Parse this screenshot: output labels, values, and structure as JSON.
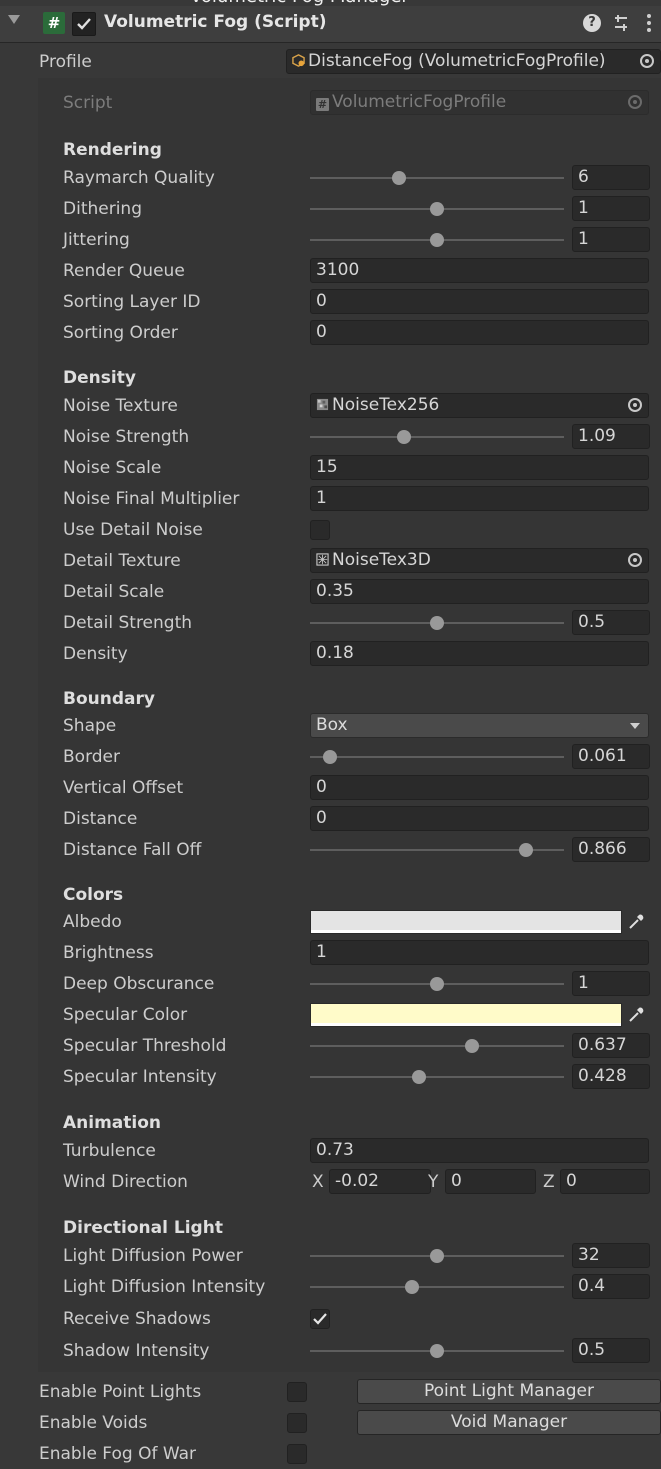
{
  "header": {
    "title": "Volumetric Fog (Script)",
    "help_icon_glyph": "?",
    "script_icon_glyph": "#"
  },
  "profile": {
    "label": "Profile",
    "value": "DistanceFog (VolumetricFogProfile)"
  },
  "script": {
    "label": "Script",
    "value": "VolumetricFogProfile"
  },
  "sections": {
    "rendering": "Rendering",
    "density": "Density",
    "boundary": "Boundary",
    "colors": "Colors",
    "animation": "Animation",
    "directional_light": "Directional Light"
  },
  "rendering": {
    "raymarch_quality": {
      "label": "Raymarch Quality",
      "value": "6",
      "level": 0.35
    },
    "dithering": {
      "label": "Dithering",
      "value": "1",
      "level": 0.5
    },
    "jittering": {
      "label": "Jittering",
      "value": "1",
      "level": 0.5
    },
    "render_queue": {
      "label": "Render Queue",
      "value": "3100"
    },
    "sorting_layer_id": {
      "label": "Sorting Layer ID",
      "value": "0"
    },
    "sorting_order": {
      "label": "Sorting Order",
      "value": "0"
    }
  },
  "density": {
    "noise_texture": {
      "label": "Noise Texture",
      "value": "NoiseTex256"
    },
    "noise_strength": {
      "label": "Noise Strength",
      "value": "1.09",
      "level": 0.37
    },
    "noise_scale": {
      "label": "Noise Scale",
      "value": "15"
    },
    "noise_final_multiplier": {
      "label": "Noise Final Multiplier",
      "value": "1"
    },
    "use_detail_noise": {
      "label": "Use Detail Noise",
      "checked": false
    },
    "detail_texture": {
      "label": "Detail Texture",
      "value": "NoiseTex3D"
    },
    "detail_scale": {
      "label": "Detail Scale",
      "value": "0.35"
    },
    "detail_strength": {
      "label": "Detail Strength",
      "value": "0.5",
      "level": 0.5
    },
    "density": {
      "label": "Density",
      "value": "0.18"
    }
  },
  "boundary": {
    "shape": {
      "label": "Shape",
      "value": "Box"
    },
    "border": {
      "label": "Border",
      "value": "0.061",
      "level": 0.08
    },
    "vertical_offset": {
      "label": "Vertical Offset",
      "value": "0"
    },
    "distance": {
      "label": "Distance",
      "value": "0"
    },
    "distance_fall_off": {
      "label": "Distance Fall Off",
      "value": "0.866",
      "level": 0.85
    }
  },
  "colors": {
    "albedo": {
      "label": "Albedo",
      "color": "#e4e4e4"
    },
    "brightness": {
      "label": "Brightness",
      "value": "1"
    },
    "deep_obscurance": {
      "label": "Deep Obscurance",
      "value": "1",
      "level": 0.5
    },
    "specular_color": {
      "label": "Specular Color",
      "color": "#fffbc9"
    },
    "specular_threshold": {
      "label": "Specular Threshold",
      "value": "0.637",
      "level": 0.637
    },
    "specular_intensity": {
      "label": "Specular Intensity",
      "value": "0.428",
      "level": 0.428
    }
  },
  "animation": {
    "turbulence": {
      "label": "Turbulence",
      "value": "0.73"
    },
    "wind_direction": {
      "label": "Wind Direction",
      "x_label": "X",
      "x": "-0.02",
      "y_label": "Y",
      "y": "0",
      "z_label": "Z",
      "z": "0"
    }
  },
  "directional_light": {
    "light_diffusion_power": {
      "label": "Light Diffusion Power",
      "value": "32",
      "level": 0.5
    },
    "light_diffusion_intensity": {
      "label": "Light Diffusion Intensity",
      "value": "0.4",
      "level": 0.4
    },
    "receive_shadows": {
      "label": "Receive Shadows",
      "checked": true
    },
    "shadow_intensity": {
      "label": "Shadow Intensity",
      "value": "0.5",
      "level": 0.5
    }
  },
  "footer": {
    "enable_point_lights": {
      "label": "Enable Point Lights",
      "checked": false,
      "button": "Point Light Manager"
    },
    "enable_voids": {
      "label": "Enable Voids",
      "checked": false,
      "button": "Void Manager"
    },
    "enable_fog_of_war": {
      "label": "Enable Fog Of War",
      "checked": false
    }
  }
}
